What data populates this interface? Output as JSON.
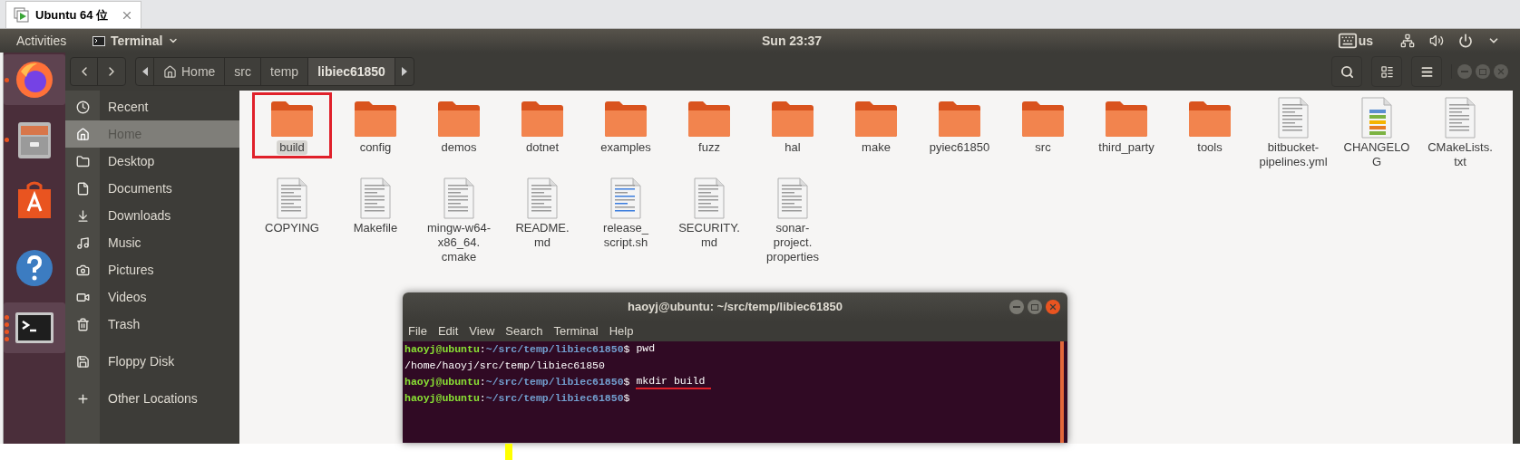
{
  "vm_tab": {
    "title": "Ubuntu 64 位"
  },
  "top_bar": {
    "activities": "Activities",
    "app_menu": "Terminal",
    "clock": "Sun 23:37",
    "keyboard_layout": "us"
  },
  "dock": [
    {
      "kind": "browser",
      "selected": true,
      "running": true,
      "multiple": false
    },
    {
      "kind": "files",
      "selected": false,
      "running": true,
      "multiple": false
    },
    {
      "kind": "store",
      "selected": false,
      "running": false
    },
    {
      "kind": "help",
      "selected": false,
      "running": false
    },
    {
      "kind": "terminal",
      "selected": true,
      "running": true,
      "multiple": true
    }
  ],
  "breadcrumb": [
    {
      "label": "Home",
      "kind": "home",
      "selected": false
    },
    {
      "label": "src",
      "kind": "folder",
      "selected": false
    },
    {
      "label": "temp",
      "kind": "folder",
      "selected": false
    },
    {
      "label": "libiec61850",
      "kind": "folder",
      "selected": true
    }
  ],
  "sidebar": {
    "places": [
      {
        "label": "Recent",
        "kind": "recent",
        "selected": false
      },
      {
        "label": "Home",
        "kind": "home",
        "selected": true
      },
      {
        "label": "Desktop",
        "kind": "desktop",
        "selected": false
      },
      {
        "label": "Documents",
        "kind": "documents",
        "selected": false
      },
      {
        "label": "Downloads",
        "kind": "downloads",
        "selected": false
      },
      {
        "label": "Music",
        "kind": "music",
        "selected": false
      },
      {
        "label": "Pictures",
        "kind": "pictures",
        "selected": false
      },
      {
        "label": "Videos",
        "kind": "videos",
        "selected": false
      },
      {
        "label": "Trash",
        "kind": "trash",
        "selected": false
      }
    ],
    "devices": [
      {
        "label": "Floppy Disk",
        "kind": "floppy",
        "selected": false
      }
    ],
    "other": [
      {
        "label": "Other Locations",
        "kind": "other",
        "selected": false
      }
    ]
  },
  "files": [
    {
      "name": "build",
      "kind": "folder",
      "selected": true,
      "annotated": true
    },
    {
      "name": "config",
      "kind": "folder",
      "selected": false,
      "annotated": false
    },
    {
      "name": "demos",
      "kind": "folder",
      "selected": false,
      "annotated": false
    },
    {
      "name": "dotnet",
      "kind": "folder",
      "selected": false,
      "annotated": false
    },
    {
      "name": "examples",
      "kind": "folder",
      "selected": false,
      "annotated": false
    },
    {
      "name": "fuzz",
      "kind": "folder",
      "selected": false,
      "annotated": false
    },
    {
      "name": "hal",
      "kind": "folder",
      "selected": false,
      "annotated": false
    },
    {
      "name": "make",
      "kind": "folder",
      "selected": false,
      "annotated": false
    },
    {
      "name": "pyiec61850",
      "kind": "folder",
      "selected": false,
      "annotated": false
    },
    {
      "name": "src",
      "kind": "folder",
      "selected": false,
      "annotated": false
    },
    {
      "name": "third_party",
      "kind": "folder",
      "selected": false,
      "annotated": false
    },
    {
      "name": "tools",
      "kind": "folder",
      "selected": false,
      "annotated": false
    },
    {
      "name": "bitbucket-pipelines.yml",
      "kind": "document",
      "selected": false,
      "annotated": false
    },
    {
      "name": "CHANGELOG",
      "kind": "changelog",
      "selected": false,
      "annotated": false
    },
    {
      "name": "CMakeLists.txt",
      "kind": "document",
      "selected": false,
      "annotated": false
    },
    {
      "name": "COPYING",
      "kind": "document",
      "selected": false,
      "annotated": false
    },
    {
      "name": "Makefile",
      "kind": "document",
      "selected": false,
      "annotated": false
    },
    {
      "name": "mingw-w64-x86_64.cmake",
      "kind": "document",
      "selected": false,
      "annotated": false
    },
    {
      "name": "README.md",
      "kind": "document",
      "selected": false,
      "annotated": false
    },
    {
      "name": "release_script.sh",
      "kind": "script",
      "selected": false,
      "annotated": false
    },
    {
      "name": "SECURITY.md",
      "kind": "document",
      "selected": false,
      "annotated": false
    },
    {
      "name": "sonar-project.properties",
      "kind": "document",
      "selected": false,
      "annotated": false
    }
  ],
  "terminal": {
    "title": "haoyj@ubuntu: ~/src/temp/libiec61850",
    "menu": [
      "File",
      "Edit",
      "View",
      "Search",
      "Terminal",
      "Help"
    ],
    "lines": [
      {
        "kind": "prompt",
        "user": "haoyj@ubuntu",
        "separator": ":",
        "path": "~/src/temp/libiec61850",
        "symbol": "$",
        "command": "pwd",
        "underlined": false
      },
      {
        "kind": "output",
        "text": "/home/haoyj/src/temp/libiec61850"
      },
      {
        "kind": "prompt",
        "user": "haoyj@ubuntu",
        "separator": ":",
        "path": "~/src/temp/libiec61850",
        "symbol": "$",
        "command": "mkdir build ",
        "underlined": true
      },
      {
        "kind": "prompt",
        "user": "haoyj@ubuntu",
        "separator": ":",
        "path": "~/src/temp/libiec61850",
        "symbol": "$"
      }
    ]
  }
}
